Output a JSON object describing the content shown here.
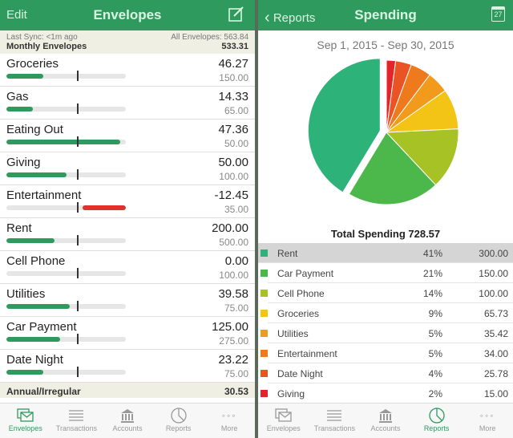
{
  "left": {
    "header": {
      "edit": "Edit",
      "title": "Envelopes"
    },
    "sync": "Last Sync: <1m ago",
    "all_envelopes": "All Envelopes: 563.84",
    "monthly": {
      "label": "Monthly Envelopes",
      "total": "533.31"
    },
    "envelopes": [
      {
        "name": "Groceries",
        "amount": "46.27",
        "budget": "150.00",
        "fill": 0.31,
        "negative": false
      },
      {
        "name": "Gas",
        "amount": "14.33",
        "budget": "65.00",
        "fill": 0.22,
        "negative": false
      },
      {
        "name": "Eating Out",
        "amount": "47.36",
        "budget": "50.00",
        "fill": 0.95,
        "negative": false
      },
      {
        "name": "Giving",
        "amount": "50.00",
        "budget": "100.00",
        "fill": 0.5,
        "negative": false
      },
      {
        "name": "Entertainment",
        "amount": "-12.45",
        "budget": "35.00",
        "fill": 0.36,
        "negative": true
      },
      {
        "name": "Rent",
        "amount": "200.00",
        "budget": "500.00",
        "fill": 0.4,
        "negative": false
      },
      {
        "name": "Cell Phone",
        "amount": "0.00",
        "budget": "100.00",
        "fill": 0,
        "negative": false
      },
      {
        "name": "Utilities",
        "amount": "39.58",
        "budget": "75.00",
        "fill": 0.53,
        "negative": false
      },
      {
        "name": "Car Payment",
        "amount": "125.00",
        "budget": "275.00",
        "fill": 0.45,
        "negative": false
      },
      {
        "name": "Date Night",
        "amount": "23.22",
        "budget": "75.00",
        "fill": 0.31,
        "negative": false
      }
    ],
    "annual": {
      "label": "Annual/Irregular",
      "total": "30.53"
    },
    "tabs": [
      "Envelopes",
      "Transactions",
      "Accounts",
      "Reports",
      "More"
    ],
    "active_tab": "Envelopes"
  },
  "right": {
    "header": {
      "back": "Reports",
      "title": "Spending",
      "calendar_day": "27"
    },
    "date_range": "Sep 1, 2015 - Sep 30, 2015",
    "total_label": "Total Spending 728.57",
    "active_tab": "Reports"
  },
  "chart_data": {
    "type": "pie",
    "title": "Sep 1, 2015 - Sep 30, 2015",
    "total": 728.57,
    "slices": [
      {
        "name": "Rent",
        "percent": "41%",
        "value": 300.0,
        "color": "#2db37a"
      },
      {
        "name": "Car Payment",
        "percent": "21%",
        "value": 150.0,
        "color": "#4cb84c"
      },
      {
        "name": "Cell Phone",
        "percent": "14%",
        "value": 100.0,
        "color": "#a6c224"
      },
      {
        "name": "Groceries",
        "percent": "9%",
        "value": 65.73,
        "color": "#f3c315"
      },
      {
        "name": "Utilities",
        "percent": "5%",
        "value": 35.42,
        "color": "#f19a1c"
      },
      {
        "name": "Entertainment",
        "percent": "5%",
        "value": 34.0,
        "color": "#ef7a1e"
      },
      {
        "name": "Date Night",
        "percent": "4%",
        "value": 25.78,
        "color": "#ea5424"
      },
      {
        "name": "Giving",
        "percent": "2%",
        "value": 15.0,
        "color": "#e3252a"
      }
    ]
  },
  "colors": {
    "brand": "#2e9a5e",
    "negative": "#e03030"
  }
}
